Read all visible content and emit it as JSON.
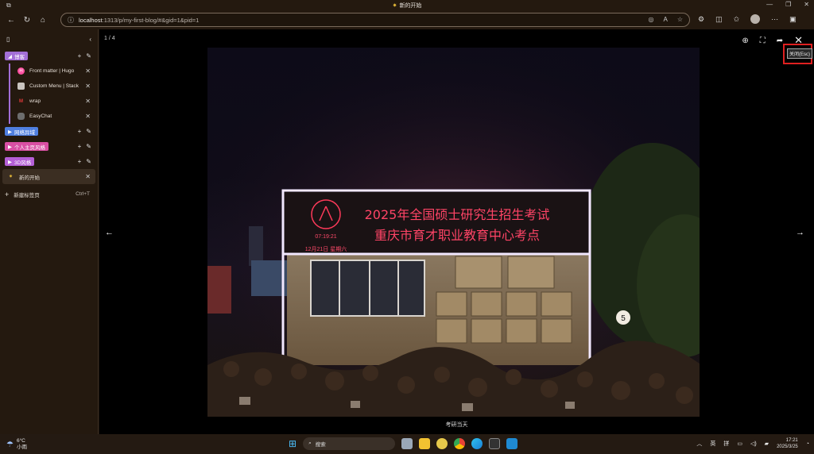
{
  "window": {
    "tab_title": "新的开始"
  },
  "address": {
    "host": "localhost",
    "path": ":1313/p/my-first-blog/#&gid=1&pid=1"
  },
  "sidebar": {
    "groups": [
      {
        "label": "博客",
        "color": "#a36fd6",
        "expanded": true,
        "tabs": [
          "Front matter | Hugo",
          "Custom Menu | Stack",
          "wrap",
          "EasyChat"
        ]
      },
      {
        "label": "网络异域",
        "color": "#4f7fe0",
        "expanded": false
      },
      {
        "label": "个人主页风格",
        "color": "#d94fa3",
        "expanded": false
      },
      {
        "label": "3D风格",
        "color": "#b55fd6",
        "expanded": false
      }
    ],
    "active_tab": "新的开始",
    "new_tab_label": "新建标签页",
    "new_tab_shortcut": "Ctrl+T"
  },
  "viewer": {
    "counter": "1 / 4",
    "tooltip": "关闭(Esc)",
    "caption": "考研当天",
    "sign_line1": "2025年全国硕士研究生招生考试",
    "sign_line2": "重庆市育才职业教育中心考点",
    "sign_time": "07:19:21",
    "sign_date": "12月21日 星期六",
    "pole_number": "5"
  },
  "taskbar": {
    "weather_temp": "6°C",
    "weather_desc": "小雨",
    "search_placeholder": "搜索",
    "lang1": "英",
    "lang2": "拼",
    "time": "17:21",
    "date": "2025/3/25"
  }
}
